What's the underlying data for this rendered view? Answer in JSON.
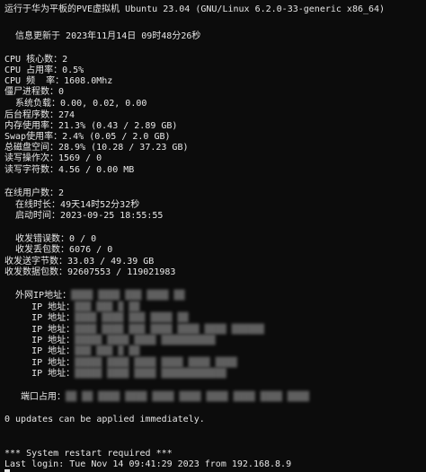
{
  "header": {
    "title": "运行于华为平板的PVE虚拟机 Ubuntu 23.04 (GNU/Linux 6.2.0-33-generic x86_64)",
    "updated": "  信息更新于 2023年11月14日 09时48分26秒"
  },
  "system": {
    "cpu_cores_label": "CPU 核心数：",
    "cpu_cores": "2",
    "cpu_usage_label": "CPU 占用率：",
    "cpu_usage": "0.5%",
    "cpu_freq_label": "CPU 频  率：",
    "cpu_freq": "1608.0Mhz",
    "zombie_label": "僵尸进程数：",
    "zombie": "0",
    "load_label": "  系统负载：",
    "load": "0.00, 0.02, 0.00",
    "bg_label": "后台程序数：",
    "bg": "274",
    "mem_label": "内存使用率：",
    "mem": "21.3% (0.43 / 2.89 GB)",
    "swap_label": "Swap使用率：",
    "swap": "2.4% (0.05 / 2.0 GB)",
    "disk_label": "总磁盘空间：",
    "disk": "28.9% (10.28 / 37.23 GB)",
    "readops_label": "读写操作次：",
    "readops": "1569 / 0",
    "readbytes_label": "读写字符数：",
    "readbytes": "4.56 / 0.00 MB"
  },
  "users": {
    "online_label": "在线用户数：",
    "online": "2",
    "uptime_label": "  在线时长：",
    "uptime": "49天14时52分32秒",
    "boot_label": "  启动时间：",
    "boot": "2023-09-25 18:55:55"
  },
  "network": {
    "rx_err_label": "  收发错误数：",
    "rx_err": "0 / 0",
    "rx_drop_label": "  收发丢包数：",
    "rx_drop": "6076 / 0",
    "tx_bytes_label": "收发送字节数：",
    "tx_bytes": "33.03 / 49.39 GB",
    "pkts_label": "收发数据包数：",
    "pkts": "92607553 / 119021983",
    "wan_label": "  外网IP地址：",
    "ip_label": "     IP 地址：",
    "ports_label": "   端口占用："
  },
  "footer": {
    "updates": "0 updates can be applied immediately.",
    "restart": "*** System restart required ***",
    "last_login": "Last login: Tue Nov 14 09:41:29 2023 from 192.168.8.9"
  }
}
